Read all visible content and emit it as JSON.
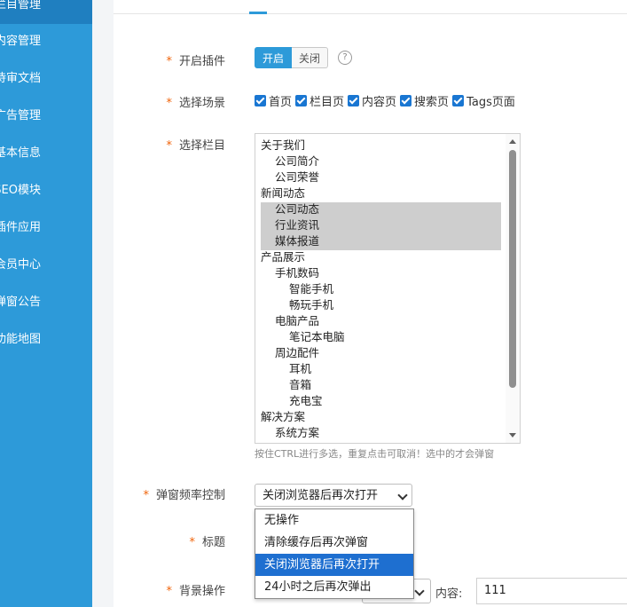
{
  "sidebar": {
    "items": [
      {
        "label": "栏目管理",
        "active": true
      },
      {
        "label": "内容管理"
      },
      {
        "label": "待审文档"
      },
      {
        "label": "广告管理"
      },
      {
        "label": "基本信息"
      },
      {
        "label": "SEO模块"
      },
      {
        "label": "插件应用"
      },
      {
        "label": "会员中心"
      },
      {
        "label": "弹窗公告"
      },
      {
        "label": "功能地图"
      }
    ]
  },
  "form": {
    "enable": {
      "label": "开启插件",
      "on_label": "开启",
      "off_label": "关闭",
      "help_glyph": "?"
    },
    "scenes": {
      "label": "选择场景",
      "options": [
        "首页",
        "栏目页",
        "内容页",
        "搜索页",
        "Tags页面"
      ]
    },
    "columns": {
      "label": "选择栏目",
      "options": [
        {
          "text": "关于我们",
          "level": 0
        },
        {
          "text": "公司简介",
          "level": 1
        },
        {
          "text": "公司荣誉",
          "level": 1
        },
        {
          "text": "新闻动态",
          "level": 0
        },
        {
          "text": "公司动态",
          "level": 1,
          "selected": true
        },
        {
          "text": "行业资讯",
          "level": 1,
          "selected": true
        },
        {
          "text": "媒体报道",
          "level": 1,
          "selected": true
        },
        {
          "text": "产品展示",
          "level": 0
        },
        {
          "text": "手机数码",
          "level": 1
        },
        {
          "text": "智能手机",
          "level": 2
        },
        {
          "text": "畅玩手机",
          "level": 2
        },
        {
          "text": "电脑产品",
          "level": 1
        },
        {
          "text": "笔记本电脑",
          "level": 2
        },
        {
          "text": "周边配件",
          "level": 1
        },
        {
          "text": "耳机",
          "level": 2
        },
        {
          "text": "音箱",
          "level": 2
        },
        {
          "text": "充电宝",
          "level": 2
        },
        {
          "text": "解决方案",
          "level": 0
        },
        {
          "text": "系统方案",
          "level": 1
        }
      ],
      "hint": "按住CTRL进行多选，重复点击可取消！选中的才会弹窗"
    },
    "frequency": {
      "label": "弹窗频率控制",
      "value": "关闭浏览器后再次打开",
      "options": [
        "无操作",
        "清除缓存后再次弹窗",
        "关闭浏览器后再次打开",
        "24小时之后再次弹出"
      ]
    },
    "title": {
      "label": "标题"
    },
    "background": {
      "label": "背景操作",
      "content_label": "内容:",
      "content_value": "111"
    }
  },
  "colors": {
    "accent": "#2d9ad9",
    "highlight": "#1e6fd0",
    "required": "#f0640a"
  }
}
